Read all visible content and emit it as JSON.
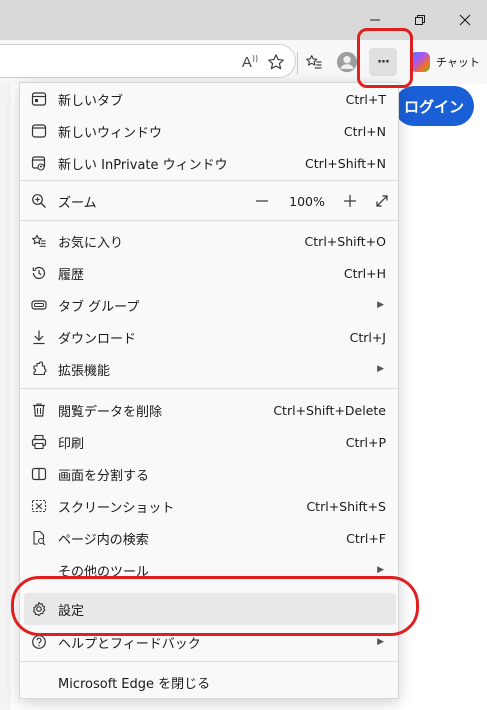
{
  "toolbar": {
    "chat_label": "チャット",
    "more_label": "···",
    "readaloud_label": "A"
  },
  "page": {
    "login_label": "ログイン"
  },
  "menu": {
    "items": [
      {
        "label": "新しいタブ",
        "shortcut": "Ctrl+T",
        "icon": "new-tab-icon"
      },
      {
        "label": "新しいウィンドウ",
        "shortcut": "Ctrl+N",
        "icon": "new-window-icon"
      },
      {
        "label": "新しい InPrivate ウィンドウ",
        "shortcut": "Ctrl+Shift+N",
        "icon": "inprivate-icon"
      },
      {
        "label": "ズーム",
        "icon": "zoom-icon"
      },
      {
        "label": "お気に入り",
        "shortcut": "Ctrl+Shift+O",
        "icon": "favorites-icon"
      },
      {
        "label": "履歴",
        "shortcut": "Ctrl+H",
        "icon": "history-icon"
      },
      {
        "label": "タブ グループ",
        "icon": "tab-groups-icon",
        "submenu": true
      },
      {
        "label": "ダウンロード",
        "shortcut": "Ctrl+J",
        "icon": "download-icon"
      },
      {
        "label": "拡張機能",
        "icon": "extensions-icon",
        "submenu": true
      },
      {
        "label": "閲覧データを削除",
        "shortcut": "Ctrl+Shift+Delete",
        "icon": "trash-icon"
      },
      {
        "label": "印刷",
        "shortcut": "Ctrl+P",
        "icon": "print-icon"
      },
      {
        "label": "画面を分割する",
        "icon": "split-screen-icon"
      },
      {
        "label": "スクリーンショット",
        "shortcut": "Ctrl+Shift+S",
        "icon": "screenshot-icon"
      },
      {
        "label": "ページ内の検索",
        "shortcut": "Ctrl+F",
        "icon": "find-icon"
      },
      {
        "label": "その他のツール",
        "submenu": true
      },
      {
        "label": "設定",
        "icon": "gear-icon",
        "highlighted": true
      },
      {
        "label": "ヘルプとフィードバック",
        "icon": "help-icon",
        "submenu": true
      },
      {
        "label": "Microsoft Edge を閉じる"
      }
    ],
    "zoom": {
      "value": "100%",
      "minus": "—",
      "plus": "+"
    }
  },
  "colors": {
    "annotation": "#e02020",
    "login_button": "#1a5fd6",
    "menu_background": "#f9f9f9",
    "highlight": "#e8e8e8"
  }
}
